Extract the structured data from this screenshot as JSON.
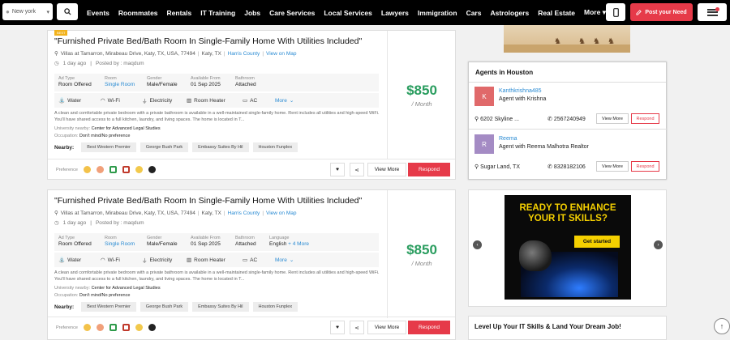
{
  "topbar": {
    "city": "New york",
    "nav": [
      "Events",
      "Roommates",
      "Rentals",
      "IT Training",
      "Jobs",
      "Care Services",
      "Local Services",
      "Lawyers",
      "Immigration",
      "Cars",
      "Astrologers",
      "Real Estate",
      "More"
    ],
    "post_label": "Post your Need"
  },
  "listings": [
    {
      "badge": "BEST",
      "title": "\"Furnished Private Bed/Bath Room In Single-Family Home With Utilities Included\"",
      "address": "Villas at Tamarron, Mirabeau Drive, Katy, TX, USA, 77494",
      "city": "Katy, TX",
      "county": "Harris County",
      "map_link": "View on Map",
      "posted_ago": "1 day ago",
      "posted_by": "Posted by : maqdum",
      "details": [
        {
          "label": "Ad Type",
          "value": "Room Offered"
        },
        {
          "label": "Room",
          "value": "Single Room"
        },
        {
          "label": "Gender",
          "value": "Male/Female"
        },
        {
          "label": "Available From",
          "value": "01 Sep 2025"
        },
        {
          "label": "Bathroom",
          "value": "Attached"
        }
      ],
      "amenities": [
        "Water",
        "Wi-Fi",
        "Electricity",
        "Room Heater",
        "AC"
      ],
      "more_label": "More",
      "description": "A clean and comfortable private bedroom with a private bathroom is available in a well-maintained single-family home. Rent includes all utilities and high-speed WiFi. You'll have shared access to a full kitchen, laundry, and living spaces. The home is located in T...",
      "university_label": "University nearby:",
      "university": "Center for Advanced Legal Studies",
      "occupation_label": "Occupation:",
      "occupation": "Don't mind/No preference",
      "nearby_label": "Nearby:",
      "nearby": [
        "Best Western Premier",
        "George Bush Park",
        "Embassy Suites By Hil",
        "Houston Funplex"
      ],
      "preference_label": "Preference",
      "price": "$850",
      "per": "/ Month",
      "view_more": "View More",
      "respond": "Respond"
    },
    {
      "title": "\"Furnished Private Bed/Bath Room In Single-Family Home With Utilities Included\"",
      "address": "Villas at Tamarron, Mirabeau Drive, Katy, TX, USA, 77494",
      "city": "Katy, TX",
      "county": "Harris County",
      "map_link": "View on Map",
      "posted_ago": "1 day ago",
      "posted_by": "Posted by : maqdum",
      "details": [
        {
          "label": "Ad Type",
          "value": "Room Offered"
        },
        {
          "label": "Room",
          "value": "Single Room"
        },
        {
          "label": "Gender",
          "value": "Male/Female"
        },
        {
          "label": "Available From",
          "value": "01 Sep 2025"
        },
        {
          "label": "Bathroom",
          "value": "Attached"
        },
        {
          "label": "Language",
          "value": "English",
          "extra": "+ 4 More"
        }
      ],
      "amenities": [
        "Water",
        "Wi-Fi",
        "Electricity",
        "Room Heater",
        "AC"
      ],
      "more_label": "More",
      "description": "A clean and comfortable private bedroom with a private bathroom is available in a well-maintained single-family home. Rent includes all utilities and high-speed WiFi. You'll have shared access to a full kitchen, laundry, and living spaces. The home is located in T...",
      "university_label": "University nearby:",
      "university": "Center for Advanced Legal Studies",
      "occupation_label": "Occupation:",
      "occupation": "Don't mind/No preference",
      "nearby_label": "Nearby:",
      "nearby": [
        "Best Western Premier",
        "George Bush Park",
        "Embassy Suites By Hil",
        "Houston Funplex"
      ],
      "preference_label": "Preference",
      "price": "$850",
      "per": "/ Month",
      "view_more": "View More",
      "respond": "Respond"
    }
  ],
  "agents": {
    "title": "Agents in Houston",
    "items": [
      {
        "initial": "K",
        "name": "Kanthkrishna485",
        "role": "Agent with Krishna",
        "location": "6202 Skyline ...",
        "phone": "2567240949",
        "view_more": "View More",
        "respond": "Respond",
        "color": "#e0696a"
      },
      {
        "initial": "R",
        "name": "Reema",
        "role": "Agent with Reema Malhotra Realtor",
        "location": "Sugar Land, TX",
        "phone": "8328182106",
        "view_more": "View More",
        "respond": "Respond",
        "color": "#a48bc4"
      }
    ]
  },
  "ad": {
    "headline_1": "READY TO ENHANCE",
    "headline_2": "YOUR IT SKILLS?",
    "cta": "Get started"
  },
  "it_box": {
    "title": "Level Up Your IT Skills & Land Your Dream Job!"
  },
  "colors": {
    "accent": "#e63a49",
    "price": "#2a9d5f",
    "link": "#2a8bd3"
  }
}
